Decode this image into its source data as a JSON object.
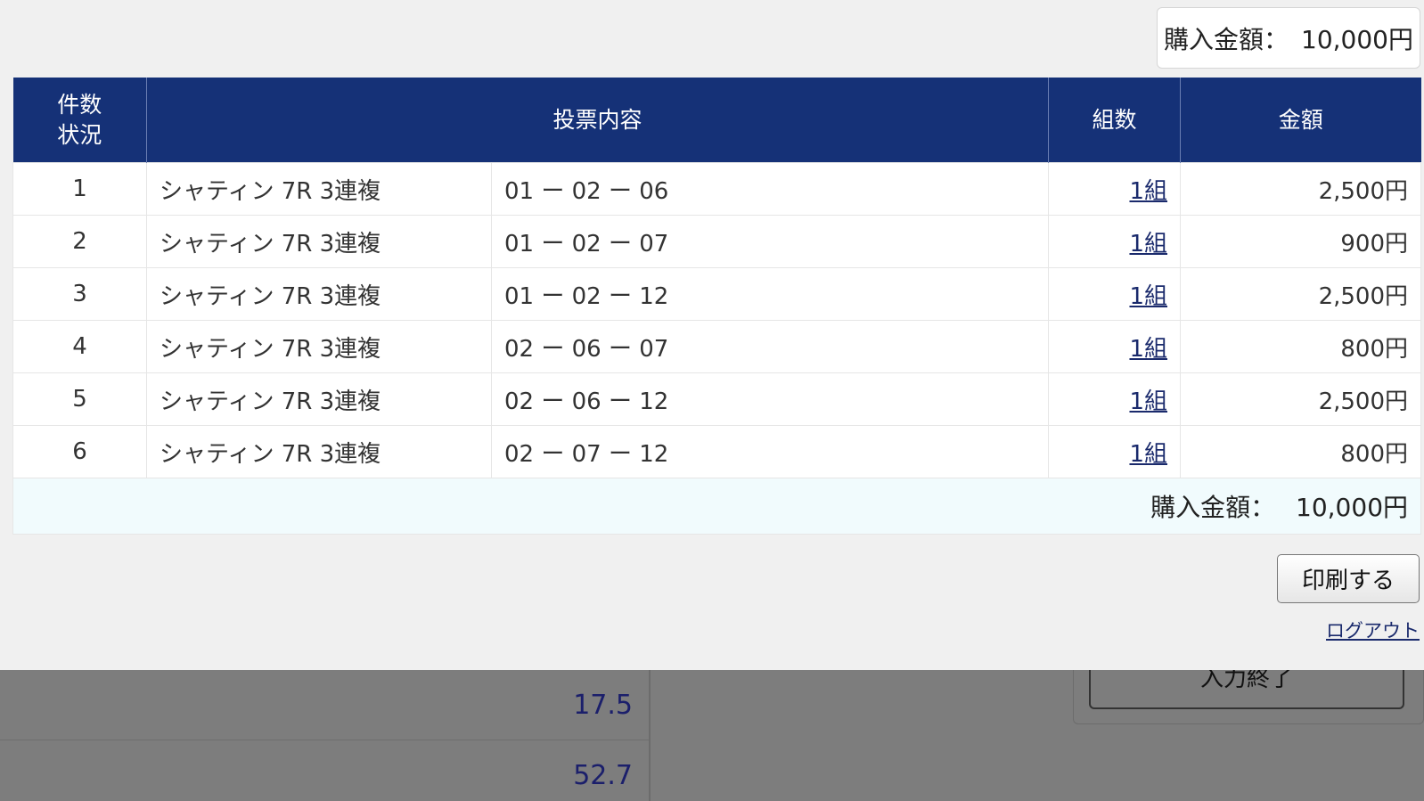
{
  "summary": {
    "label": "購入金額：",
    "amount": "10,000円"
  },
  "table": {
    "headers": {
      "count_status": [
        "件数",
        "状況"
      ],
      "content": "投票内容",
      "kumi": "組数",
      "amount": "金額"
    },
    "rows": [
      {
        "no": "1",
        "race": "シャティン 7R 3連複",
        "combo": "01 ー 02 ー 06",
        "kumi": "1組",
        "amount": "2,500円"
      },
      {
        "no": "2",
        "race": "シャティン 7R 3連複",
        "combo": "01 ー 02 ー 07",
        "kumi": "1組",
        "amount": "900円"
      },
      {
        "no": "3",
        "race": "シャティン 7R 3連複",
        "combo": "01 ー 02 ー 12",
        "kumi": "1組",
        "amount": "2,500円"
      },
      {
        "no": "4",
        "race": "シャティン 7R 3連複",
        "combo": "02 ー 06 ー 07",
        "kumi": "1組",
        "amount": "800円"
      },
      {
        "no": "5",
        "race": "シャティン 7R 3連複",
        "combo": "02 ー 06 ー 12",
        "kumi": "1組",
        "amount": "2,500円"
      },
      {
        "no": "6",
        "race": "シャティン 7R 3連複",
        "combo": "02 ー 07 ー 12",
        "kumi": "1組",
        "amount": "800円"
      }
    ],
    "footer_label": "購入金額：",
    "footer_amount": "10,000円"
  },
  "actions": {
    "print_label": "印刷する",
    "logout_label": "ログアウト"
  },
  "background": {
    "values": [
      "17.5",
      "52.7"
    ],
    "button_label": "入力終了"
  },
  "colors": {
    "header_bg": "#153177",
    "link": "#1a2a6c",
    "footer_bg": "#f1fbfd"
  }
}
